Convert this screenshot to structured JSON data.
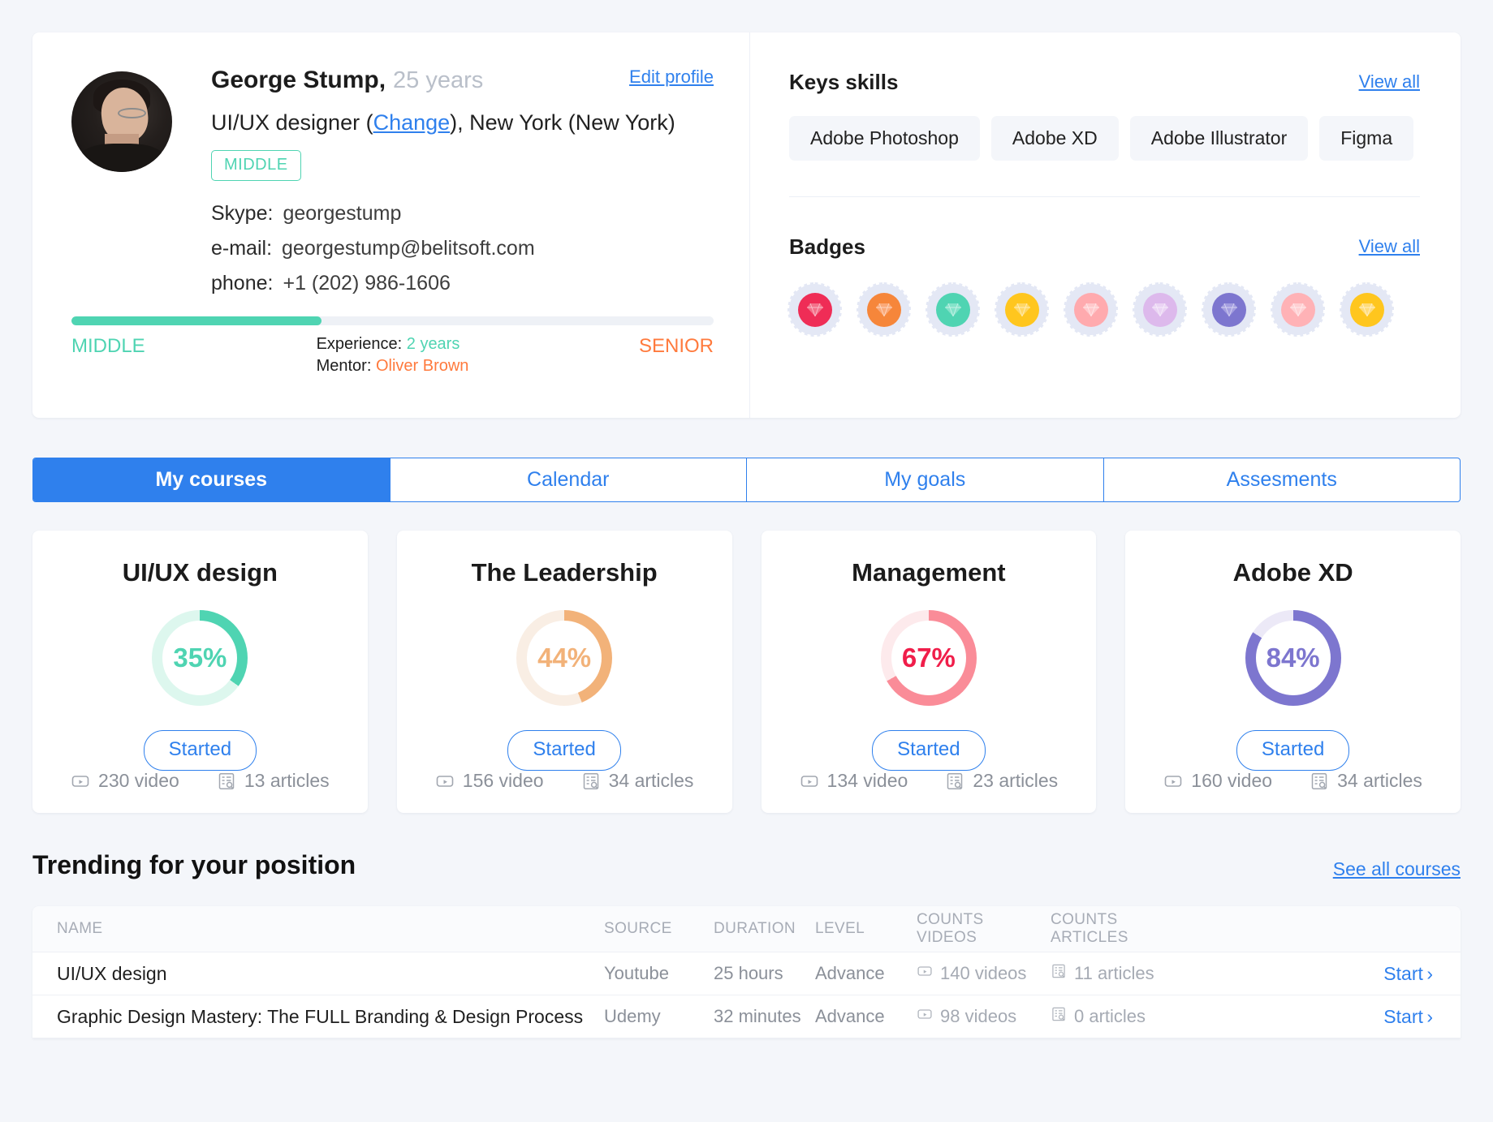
{
  "profile": {
    "name": "George Stump,",
    "age": "25 years",
    "edit_label": "Edit profile",
    "role_prefix": "UI/UX designer (",
    "role_change_link": "Change",
    "role_suffix": "), New York (New York)",
    "level_chip": "MIDDLE",
    "contacts": [
      {
        "key": "Skype:",
        "value": "georgestump"
      },
      {
        "key": "e-mail:",
        "value": "georgestump@belitsoft.com"
      },
      {
        "key": "phone:",
        "value": "+1 (202) 986-1606"
      }
    ],
    "progress": {
      "percent": 39,
      "min_label": "MIDDLE",
      "max_label": "SENIOR",
      "experience_key": "Experience:",
      "experience_value": "2 years",
      "mentor_key": "Mentor:",
      "mentor_value": "Oliver Brown",
      "fill_color": "#4fd4b2",
      "max_color": "#ff7a3d"
    }
  },
  "skills": {
    "title": "Keys skills",
    "view_all": "View all",
    "items": [
      "Adobe Photoshop",
      "Adobe XD",
      "Adobe Illustrator",
      "Figma"
    ]
  },
  "badges": {
    "title": "Badges",
    "view_all": "View all",
    "items": [
      {
        "name": "badge-crimson",
        "color": "#ef2d56",
        "inner": "#f3728a"
      },
      {
        "name": "badge-orange",
        "color": "#f6863a",
        "inner": "#fba978"
      },
      {
        "name": "badge-teal",
        "color": "#4fd4b2",
        "inner": "#84e3ca"
      },
      {
        "name": "badge-gold",
        "color": "#ffc61e",
        "inner": "#ffd765"
      },
      {
        "name": "badge-pink",
        "color": "#ffaaae",
        "inner": "#ffc9cc"
      },
      {
        "name": "badge-lavender",
        "color": "#ddb9ec",
        "inner": "#ead4f4"
      },
      {
        "name": "badge-violet",
        "color": "#7d76cf",
        "inner": "#a49ee0"
      },
      {
        "name": "badge-rose",
        "color": "#ffb2b6",
        "inner": "#ffd0d3"
      },
      {
        "name": "badge-amber",
        "color": "#ffc61e",
        "inner": "#ffdc7d"
      }
    ]
  },
  "tabs": [
    {
      "label": "My courses",
      "active": true
    },
    {
      "label": "Calendar",
      "active": false
    },
    {
      "label": "My goals",
      "active": false
    },
    {
      "label": "Assesments",
      "active": false
    }
  ],
  "courses": [
    {
      "title": "UI/UX design",
      "percent": 35,
      "percent_label": "35%",
      "color": "#4fd4b2",
      "track": "#ddf7ee",
      "button": "Started",
      "videos": "230 video",
      "articles": "13 articles"
    },
    {
      "title": "The Leadership",
      "percent": 44,
      "percent_label": "44%",
      "color": "#f2b279",
      "track": "#f9eee4",
      "button": "Started",
      "videos": "156 video",
      "articles": "34 articles"
    },
    {
      "title": "Management",
      "percent": 67,
      "percent_label": "67%",
      "color": "#fa8c98",
      "track": "#fdeaec",
      "button": "Started",
      "videos": "134 video",
      "articles": "23 articles",
      "label_color": "#f01e4a"
    },
    {
      "title": "Adobe XD",
      "percent": 84,
      "percent_label": "84%",
      "color": "#7d76cf",
      "track": "#ece9f7",
      "button": "Started",
      "videos": "160 video",
      "articles": "34 articles"
    }
  ],
  "trending": {
    "title": "Trending for your position",
    "see_all": "See all courses",
    "columns": [
      "NAME",
      "SOURCE",
      "DURATION",
      "LEVEL",
      "COUNTS VIDEOS",
      "COUNTS ARTICLES"
    ],
    "action_label": "Start",
    "rows": [
      {
        "name": "UI/UX design",
        "source": "Youtube",
        "duration": "25 hours",
        "level": "Advance",
        "videos": "140 videos",
        "articles": "11 articles",
        "action": "Start"
      },
      {
        "name": "Graphic Design Mastery: The FULL Branding & Design Process",
        "source": "Udemy",
        "duration": "32 minutes",
        "level": "Advance",
        "videos": "98 videos",
        "articles": "0 articles",
        "action": "Start"
      }
    ]
  }
}
